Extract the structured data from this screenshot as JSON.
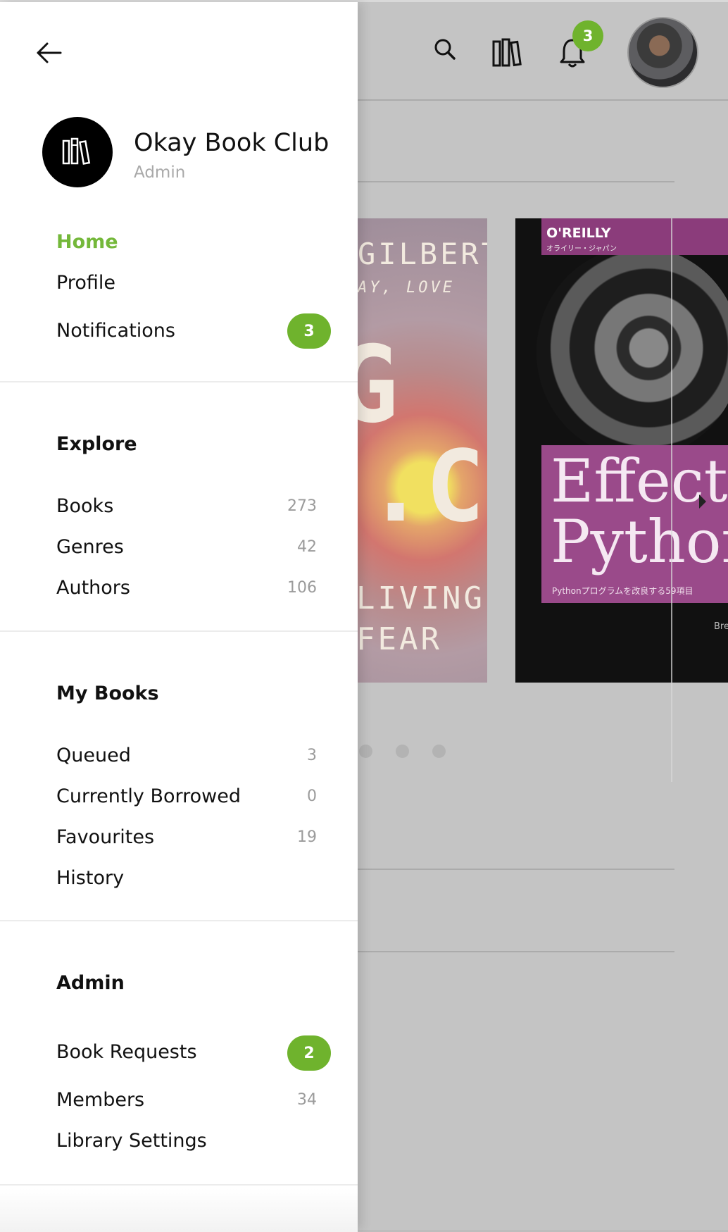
{
  "header": {
    "notification_count": "3",
    "icons": [
      "search-icon",
      "library-icon",
      "bell-icon"
    ]
  },
  "books_preview": [
    {
      "lines": [
        "GILBERT",
        "AY, LOVE",
        "G",
        ".C",
        "LIVING",
        "FEAR"
      ]
    },
    {
      "publisher": "O'REILLY",
      "publisher_sub": "オライリー・ジャパン",
      "title_line1": "Effectiv",
      "title_line2": "Python",
      "subtitle": "Pythonプログラムを改良する59項目",
      "author_fragment": "Bre"
    }
  ],
  "drawer": {
    "club": {
      "name": "Okay Book Club",
      "role": "Admin"
    },
    "main_nav": [
      {
        "label": "Home",
        "active": true
      },
      {
        "label": "Profile"
      },
      {
        "label": "Notifications",
        "badge": "3"
      }
    ],
    "explore": {
      "title": "Explore",
      "items": [
        {
          "label": "Books",
          "count": "273"
        },
        {
          "label": "Genres",
          "count": "42"
        },
        {
          "label": "Authors",
          "count": "106"
        }
      ]
    },
    "my_books": {
      "title": "My Books",
      "items": [
        {
          "label": "Queued",
          "count": "3"
        },
        {
          "label": "Currently Borrowed",
          "count": "0"
        },
        {
          "label": "Favourites",
          "count": "19"
        },
        {
          "label": "History",
          "count": ""
        }
      ]
    },
    "admin": {
      "title": "Admin",
      "items": [
        {
          "label": "Book Requests",
          "badge": "2"
        },
        {
          "label": "Members",
          "count": "34"
        },
        {
          "label": "Library Settings",
          "count": ""
        }
      ]
    }
  },
  "colors": {
    "accent": "#74b83a",
    "badge": "#6fb32d",
    "overlay": "#c4c4c4"
  }
}
